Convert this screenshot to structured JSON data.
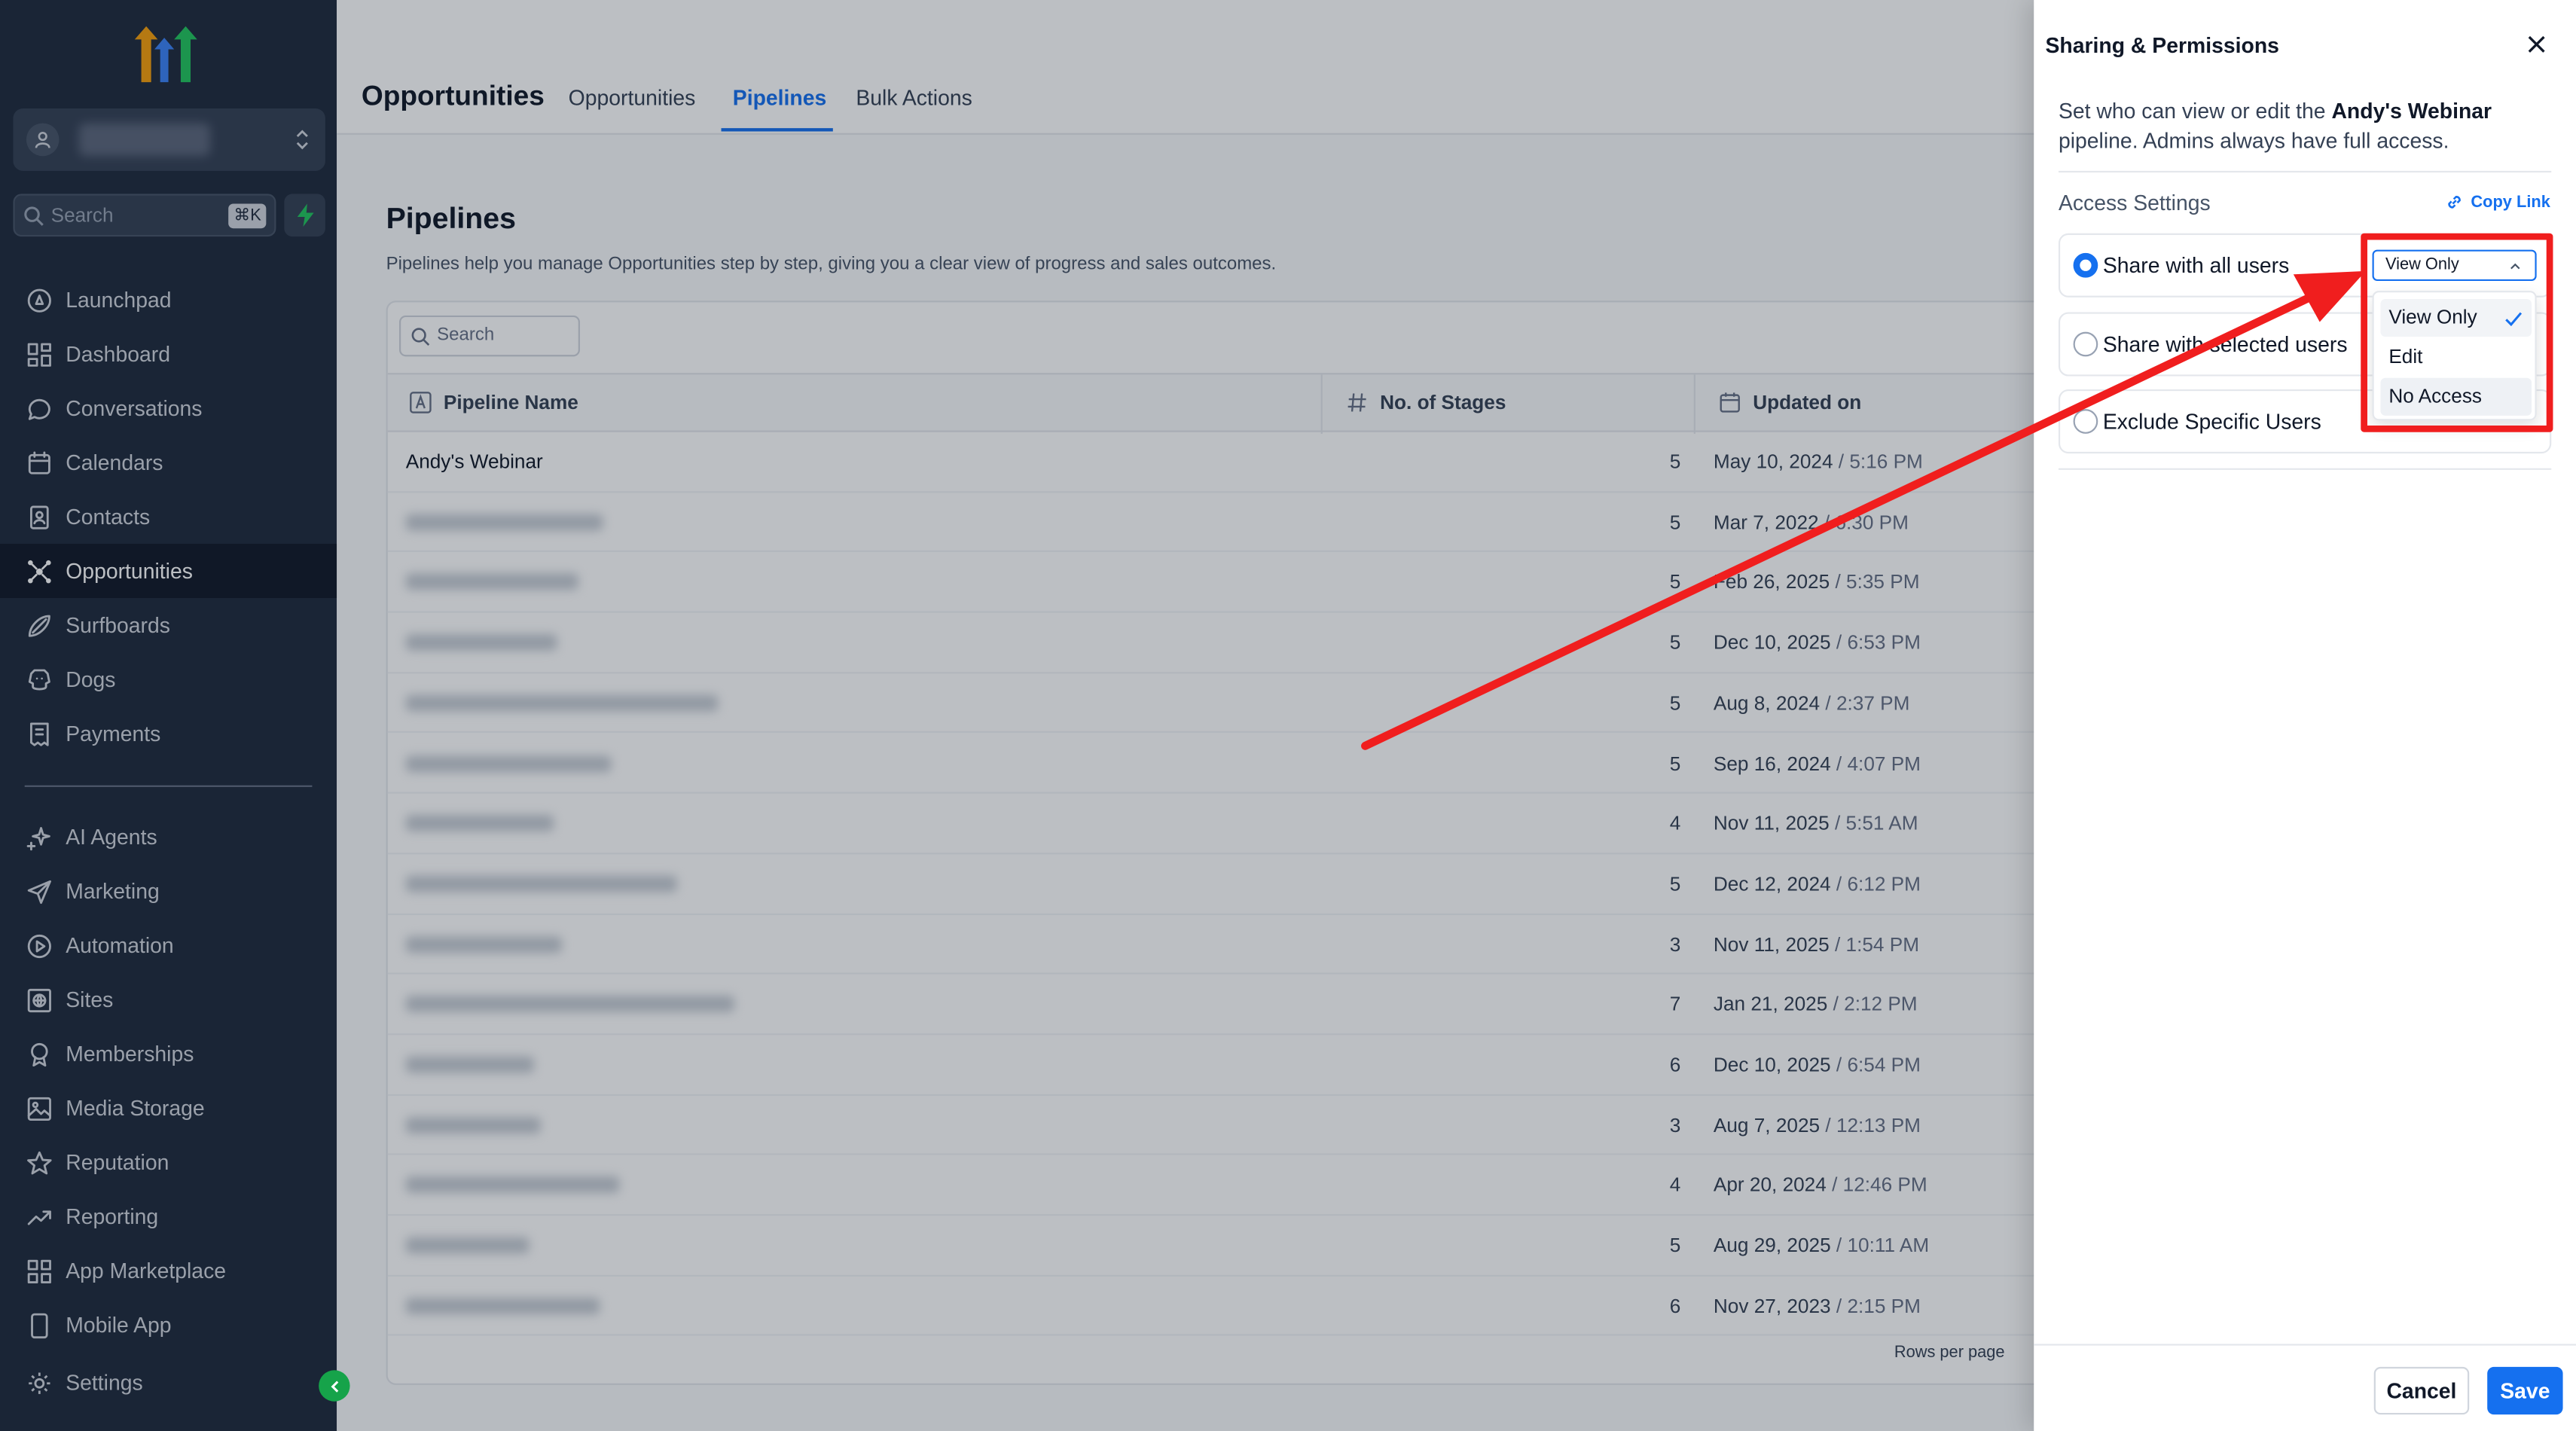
{
  "sidebar": {
    "search_placeholder": "Search",
    "search_shortcut": "⌘K",
    "nav_primary": [
      {
        "label": "Launchpad",
        "icon": "rocket-icon"
      },
      {
        "label": "Dashboard",
        "icon": "dashboard-icon"
      },
      {
        "label": "Conversations",
        "icon": "chat-icon"
      },
      {
        "label": "Calendars",
        "icon": "calendar-icon"
      },
      {
        "label": "Contacts",
        "icon": "contacts-icon"
      },
      {
        "label": "Opportunities",
        "icon": "opportunities-icon",
        "active": true
      },
      {
        "label": "Surfboards",
        "icon": "surfboard-icon"
      },
      {
        "label": "Dogs",
        "icon": "dog-icon"
      },
      {
        "label": "Payments",
        "icon": "payments-icon"
      }
    ],
    "nav_secondary": [
      {
        "label": "AI Agents",
        "icon": "sparkle-icon"
      },
      {
        "label": "Marketing",
        "icon": "send-icon"
      },
      {
        "label": "Automation",
        "icon": "automation-icon"
      },
      {
        "label": "Sites",
        "icon": "globe-icon"
      },
      {
        "label": "Memberships",
        "icon": "badge-icon"
      },
      {
        "label": "Media Storage",
        "icon": "image-icon"
      },
      {
        "label": "Reputation",
        "icon": "star-icon"
      },
      {
        "label": "Reporting",
        "icon": "trend-icon"
      },
      {
        "label": "App Marketplace",
        "icon": "grid-icon"
      },
      {
        "label": "Mobile App",
        "icon": "mobile-icon"
      }
    ],
    "settings_label": "Settings"
  },
  "header": {
    "title": "Opportunities",
    "tabs": [
      {
        "label": "Opportunities",
        "active": false
      },
      {
        "label": "Pipelines",
        "active": true
      },
      {
        "label": "Bulk Actions",
        "active": false
      }
    ]
  },
  "page": {
    "title": "Pipelines",
    "subtitle": "Pipelines help you manage Opportunities step by step, giving you a clear view of progress and sales outcomes.",
    "search_placeholder": "Search",
    "columns": [
      "Pipeline Name",
      "No. of Stages",
      "Updated on"
    ],
    "rows": [
      {
        "name": "Andy's Webinar",
        "stages": "5",
        "date": "May 10, 2024",
        "time": "5:16 PM"
      },
      {
        "name": "",
        "stages": "5",
        "date": "Mar 7, 2022",
        "time": "6:30 PM"
      },
      {
        "name": "",
        "stages": "5",
        "date": "Feb 26, 2025",
        "time": "5:35 PM"
      },
      {
        "name": "",
        "stages": "5",
        "date": "Dec 10, 2025",
        "time": "6:53 PM"
      },
      {
        "name": "",
        "stages": "5",
        "date": "Aug 8, 2024",
        "time": "2:37 PM"
      },
      {
        "name": "",
        "stages": "5",
        "date": "Sep 16, 2024",
        "time": "4:07 PM"
      },
      {
        "name": "",
        "stages": "4",
        "date": "Nov 11, 2025",
        "time": "5:51 AM"
      },
      {
        "name": "",
        "stages": "5",
        "date": "Dec 12, 2024",
        "time": "6:12 PM"
      },
      {
        "name": "",
        "stages": "3",
        "date": "Nov 11, 2025",
        "time": "1:54 PM"
      },
      {
        "name": "",
        "stages": "7",
        "date": "Jan 21, 2025",
        "time": "2:12 PM"
      },
      {
        "name": "",
        "stages": "6",
        "date": "Dec 10, 2025",
        "time": "6:54 PM"
      },
      {
        "name": "",
        "stages": "3",
        "date": "Aug 7, 2025",
        "time": "12:13 PM"
      },
      {
        "name": "",
        "stages": "4",
        "date": "Apr 20, 2024",
        "time": "12:46 PM"
      },
      {
        "name": "",
        "stages": "5",
        "date": "Aug 29, 2025",
        "time": "10:11 AM"
      },
      {
        "name": "",
        "stages": "6",
        "date": "Nov 27, 2023",
        "time": "2:15 PM"
      }
    ],
    "rows_per_page_label": "Rows per page"
  },
  "drawer": {
    "title": "Sharing & Permissions",
    "desc_prefix": "Set who can view or edit the ",
    "desc_pipeline": "Andy's Webinar",
    "desc_suffix": " pipeline. Admins always have full access.",
    "access_label": "Access Settings",
    "copy_link": "Copy Link",
    "options": [
      {
        "label": "Share with all users",
        "selected": true
      },
      {
        "label": "Share with selected users",
        "selected": false
      },
      {
        "label": "Exclude Specific Users",
        "selected": false
      }
    ],
    "permission_value": "View Only",
    "permission_options": [
      "View Only",
      "Edit",
      "No Access"
    ],
    "cancel": "Cancel",
    "save": "Save"
  },
  "colors": {
    "sidebar_bg": "#1f2a3c",
    "accent": "#1570ef",
    "annotation": "#f01e1e"
  }
}
